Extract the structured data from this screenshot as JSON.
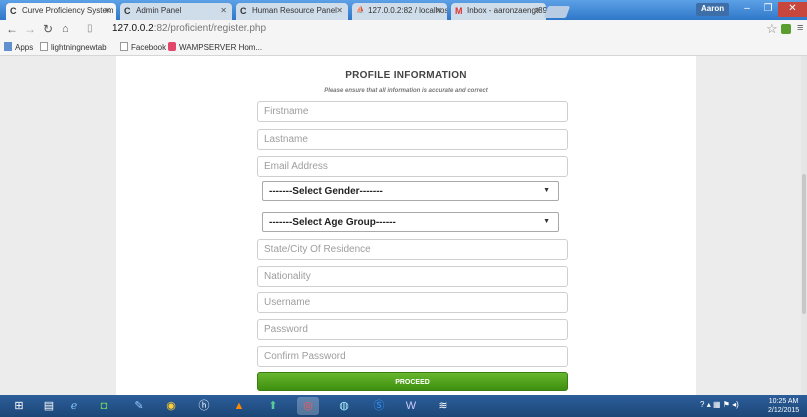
{
  "tabs": [
    {
      "label": "Curve Proficiency System",
      "favicon": "C",
      "active": true
    },
    {
      "label": "Admin Panel",
      "favicon": "C",
      "active": false
    },
    {
      "label": "Human Resource Panel",
      "favicon": "C",
      "active": false
    },
    {
      "label": "127.0.0.2:82 / localhost / ;",
      "favicon": "pma",
      "active": false
    },
    {
      "label": "Inbox - aaronzaengt89@gm",
      "favicon": "M",
      "active": false
    }
  ],
  "window": {
    "user": "Aaron",
    "minimize": "–",
    "restore": "❐",
    "close": "✕"
  },
  "address": {
    "host": "127.0.0.2",
    "path": ":82/proficient/register.php"
  },
  "bookmarks": [
    "Apps",
    "lightningnewtab",
    "Facebook",
    "WAMPSERVER Hom..."
  ],
  "form": {
    "title": "PROFILE INFORMATION",
    "subtitle": "Please ensure that all information is accurate and correct",
    "firstname": "Firstname",
    "lastname": "Lastname",
    "email": "Email Address",
    "gender": "-------Select Gender-------",
    "age_group": "-------Select Age Group------",
    "state": "State/City Of Residence",
    "nationality": "Nationality",
    "username": "Username",
    "password": "Password",
    "confirm_password": "Confirm Password",
    "proceed": "PROCEED"
  },
  "clock": {
    "time": "10:25 AM",
    "date": "2/12/2015"
  },
  "colors": {
    "accent": "#4fa21e",
    "titlebar": "#2f78c9",
    "taskbar": "#1b4677"
  }
}
